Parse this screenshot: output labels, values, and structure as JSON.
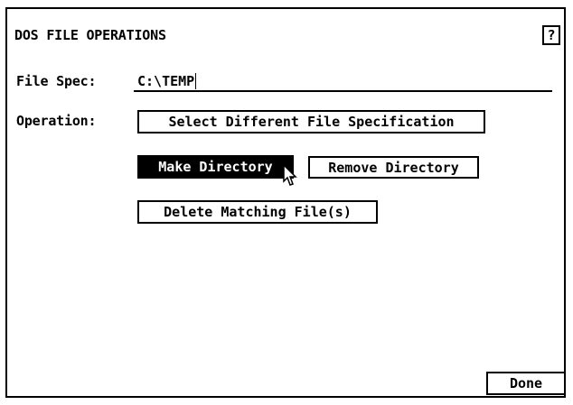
{
  "window": {
    "title": "DOS FILE OPERATIONS",
    "help_label": "?"
  },
  "filespec": {
    "label": "File Spec:",
    "value": "C:\\TEMP"
  },
  "operation": {
    "label": "Operation:",
    "select_label": "Select Different File Specification",
    "mkdir_label": "Make Directory",
    "rmdir_label": "Remove Directory",
    "delete_label": "Delete Matching File(s)"
  },
  "footer": {
    "done_label": "Done"
  },
  "icons": {
    "cursor": "mouse-pointer-icon"
  },
  "colors": {
    "foreground": "#000000",
    "background": "#ffffff",
    "highlight": "#000000"
  }
}
